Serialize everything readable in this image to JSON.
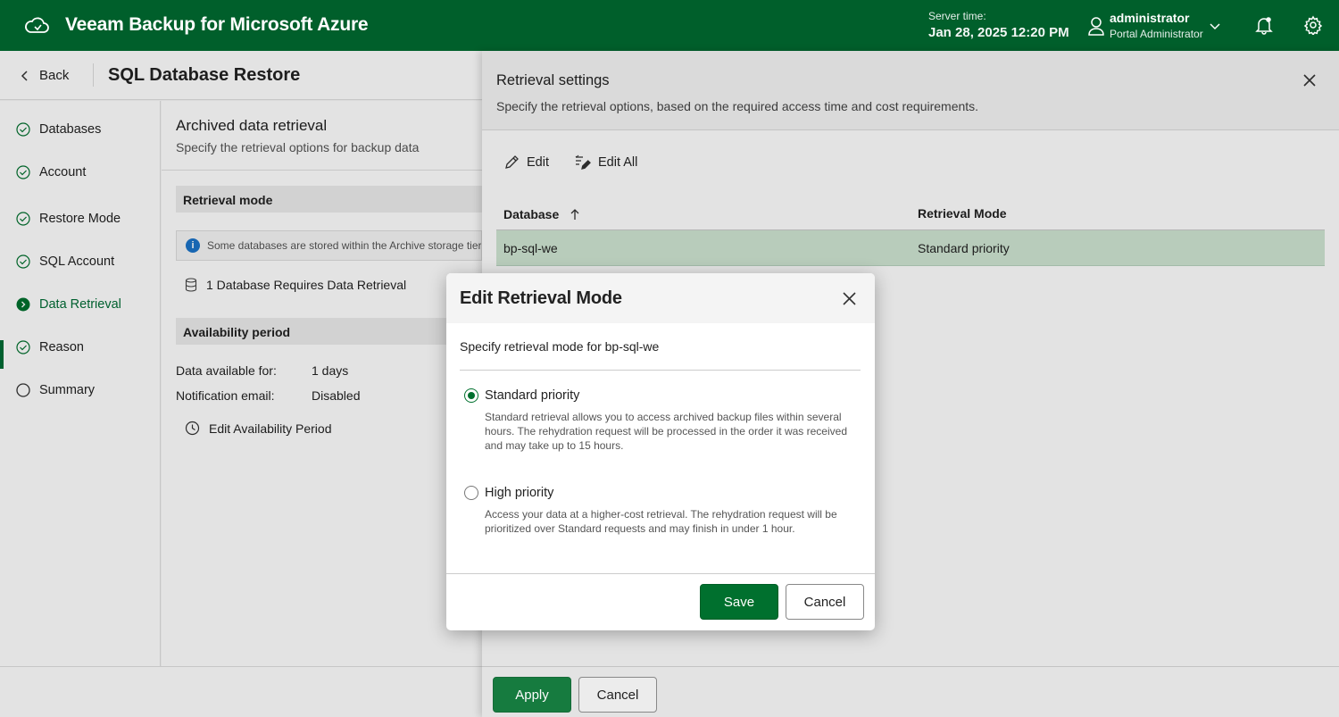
{
  "header": {
    "app_title": "Veeam Backup for Microsoft Azure",
    "server_time_label": "Server time:",
    "server_time_value": "Jan 28, 2025 12:20 PM",
    "user_name": "administrator",
    "user_role": "Portal Administrator",
    "brand_color": "#005f2b"
  },
  "page": {
    "back_label": "Back",
    "title": "SQL Database Restore"
  },
  "steps": [
    {
      "label": "Databases",
      "state": "done"
    },
    {
      "label": "Account",
      "state": "done"
    },
    {
      "label": "Restore Mode",
      "state": "done"
    },
    {
      "label": "SQL Account",
      "state": "done"
    },
    {
      "label": "Data Retrieval",
      "state": "active"
    },
    {
      "label": "Reason",
      "state": "done"
    },
    {
      "label": "Summary",
      "state": "pending"
    }
  ],
  "content": {
    "section_title": "Archived data retrieval",
    "section_subtitle": "Specify the retrieval options for backup data",
    "retrieval_mode_heading": "Retrieval mode",
    "info_text": "Some databases are stored within the Archive storage tier",
    "db_requirement": "1 Database Requires Data Retrieval",
    "availability_heading": "Availability period",
    "data_available_label": "Data available for:",
    "data_available_value": "1 days",
    "notification_label": "Notification email:",
    "notification_value": "Disabled",
    "edit_period_label": "Edit Availability Period"
  },
  "panel": {
    "title": "Retrieval settings",
    "subtitle": "Specify the retrieval options, based on the required access time and cost requirements.",
    "edit_label": "Edit",
    "edit_all_label": "Edit All",
    "columns": [
      "Database",
      "Retrieval Mode"
    ],
    "rows": [
      {
        "database": "bp-sql-we",
        "mode": "Standard priority"
      }
    ],
    "apply_label": "Apply",
    "cancel_label": "Cancel"
  },
  "modal": {
    "title": "Edit Retrieval Mode",
    "subtitle": "Specify retrieval mode for bp-sql-we",
    "options": [
      {
        "label": "Standard priority",
        "checked": true,
        "description": "Standard retrieval allows you to access archived backup files within several hours. The rehydration request will be processed in the order it was received and may take up to 15 hours."
      },
      {
        "label": "High priority",
        "checked": false,
        "description": "Access your data at a higher-cost retrieval. The rehydration request will be prioritized over Standard requests and may finish in under 1 hour."
      }
    ],
    "save_label": "Save",
    "cancel_label": "Cancel"
  }
}
